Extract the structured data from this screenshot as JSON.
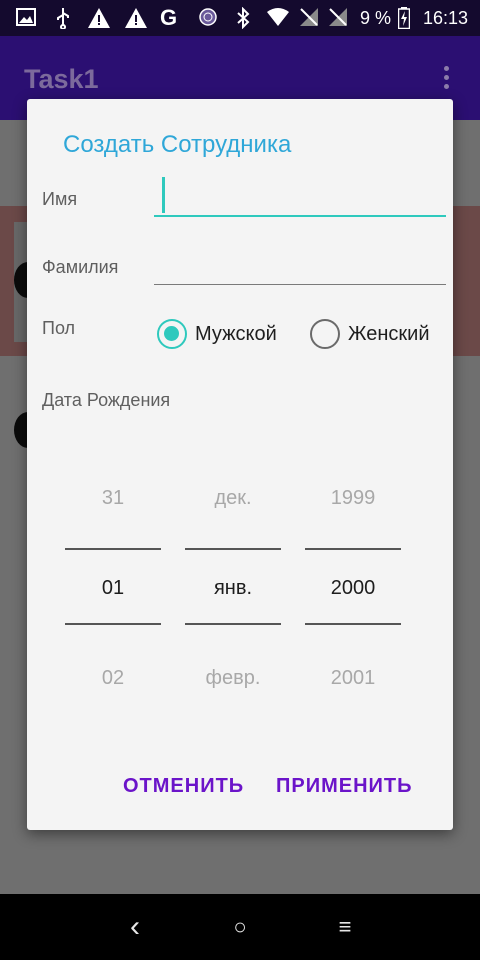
{
  "status_bar": {
    "battery_percent": "9 %",
    "time": "16:13",
    "icons": [
      "image-icon",
      "usb-icon",
      "warning-icon",
      "warning-icon",
      "google-icon",
      "sphere-icon",
      "bluetooth-icon",
      "wifi-icon",
      "no-sim-icon",
      "no-sim-icon",
      "battery-icon"
    ]
  },
  "app_bar": {
    "title": "Task1",
    "menu_icon": "overflow-menu-icon"
  },
  "dialog": {
    "title": "Создать Сотрудника",
    "name_label": "Имя",
    "name_value": "",
    "surname_label": "Фамилия",
    "surname_value": "",
    "gender_label": "Пол",
    "gender_options": [
      {
        "label": "Мужской",
        "selected": true
      },
      {
        "label": "Женский",
        "selected": false
      }
    ],
    "birth_label": "Дата Рождения",
    "date_picker": {
      "day": {
        "prev": "31",
        "current": "01",
        "next": "02"
      },
      "month": {
        "prev": "дек.",
        "current": "янв.",
        "next": "февр."
      },
      "year": {
        "prev": "1999",
        "current": "2000",
        "next": "2001"
      }
    },
    "cancel_label": "ОТМЕНИТЬ",
    "apply_label": "ПРИМЕНИТЬ"
  },
  "nav_bar": {
    "back_glyph": "‹",
    "home_glyph": "○",
    "menu_glyph": "≡"
  },
  "colors": {
    "accent": "#2ec9bd",
    "title": "#2fa7d8",
    "button": "#6b14c9",
    "app_bar": "#2b0f72"
  }
}
